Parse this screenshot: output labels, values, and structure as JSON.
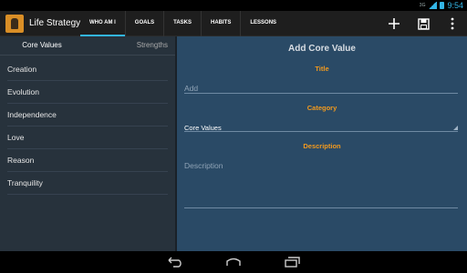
{
  "status_bar": {
    "time": "9:54",
    "signal_label": "3G",
    "icons": [
      "signal-icon",
      "battery-icon"
    ]
  },
  "action_bar": {
    "app_title": "Life Strategy",
    "tabs": [
      {
        "label": "WHO AM I",
        "active": true
      },
      {
        "label": "GOALS",
        "active": false
      },
      {
        "label": "TASKS",
        "active": false
      },
      {
        "label": "HABITS",
        "active": false
      },
      {
        "label": "LESSONS",
        "active": false
      }
    ],
    "actions": [
      "add-icon",
      "save-icon",
      "overflow-menu-icon"
    ]
  },
  "sidebar": {
    "tabs": [
      {
        "label": "Core Values",
        "active": true
      },
      {
        "label": "Strengths",
        "active": false
      }
    ],
    "items": [
      "Creation",
      "Evolution",
      "Independence",
      "Love",
      "Reason",
      "Tranquility"
    ]
  },
  "form": {
    "title": "Add Core Value",
    "title_label": "Title",
    "title_placeholder": "Add",
    "category_label": "Category",
    "category_value": "Core Values",
    "description_label": "Description",
    "description_placeholder": "Description"
  },
  "colors": {
    "accent": "#33b5e5",
    "label": "#f39a1d",
    "sidebar_bg": "#27323c",
    "form_bg": "#2a4a66"
  },
  "nav_bar": [
    "back-icon",
    "home-icon",
    "recents-icon"
  ]
}
